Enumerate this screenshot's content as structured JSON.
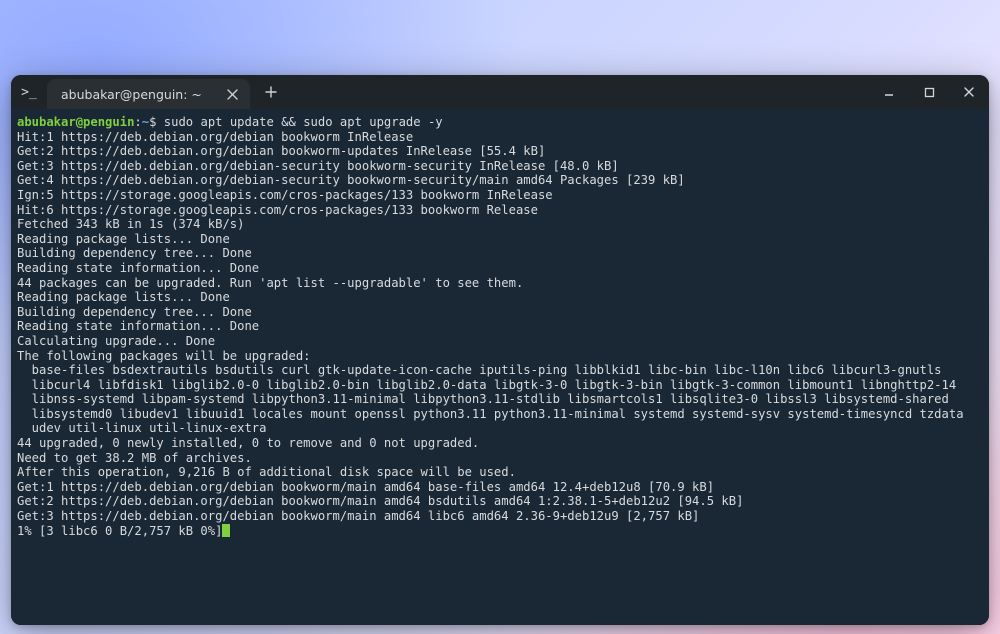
{
  "window": {
    "app_prompt_glyph": ">_",
    "tab_title": "abubakar@penguin: ~",
    "controls": {
      "minimize": "minimize",
      "maximize": "maximize",
      "close": "close"
    }
  },
  "prompt": {
    "user": "abubakar",
    "at": "@",
    "host": "penguin",
    "colon": ":",
    "path": "~",
    "dollar": "$ ",
    "command": "sudo apt update && sudo apt upgrade -y"
  },
  "lines": [
    "Hit:1 https://deb.debian.org/debian bookworm InRelease",
    "Get:2 https://deb.debian.org/debian bookworm-updates InRelease [55.4 kB]",
    "Get:3 https://deb.debian.org/debian-security bookworm-security InRelease [48.0 kB]",
    "Get:4 https://deb.debian.org/debian-security bookworm-security/main amd64 Packages [239 kB]",
    "Ign:5 https://storage.googleapis.com/cros-packages/133 bookworm InRelease",
    "Hit:6 https://storage.googleapis.com/cros-packages/133 bookworm Release",
    "Fetched 343 kB in 1s (374 kB/s)",
    "Reading package lists... Done",
    "Building dependency tree... Done",
    "Reading state information... Done",
    "44 packages can be upgraded. Run 'apt list --upgradable' to see them.",
    "Reading package lists... Done",
    "Building dependency tree... Done",
    "Reading state information... Done",
    "Calculating upgrade... Done",
    "The following packages will be upgraded:",
    "  base-files bsdextrautils bsdutils curl gtk-update-icon-cache iputils-ping libblkid1 libc-bin libc-l10n libc6 libcurl3-gnutls",
    "  libcurl4 libfdisk1 libglib2.0-0 libglib2.0-bin libglib2.0-data libgtk-3-0 libgtk-3-bin libgtk-3-common libmount1 libnghttp2-14",
    "  libnss-systemd libpam-systemd libpython3.11-minimal libpython3.11-stdlib libsmartcols1 libsqlite3-0 libssl3 libsystemd-shared",
    "  libsystemd0 libudev1 libuuid1 locales mount openssl python3.11 python3.11-minimal systemd systemd-sysv systemd-timesyncd tzdata",
    "  udev util-linux util-linux-extra",
    "44 upgraded, 0 newly installed, 0 to remove and 0 not upgraded.",
    "Need to get 38.2 MB of archives.",
    "After this operation, 9,216 B of additional disk space will be used.",
    "Get:1 https://deb.debian.org/debian bookworm/main amd64 base-files amd64 12.4+deb12u8 [70.9 kB]",
    "Get:2 https://deb.debian.org/debian bookworm/main amd64 bsdutils amd64 1:2.38.1-5+deb12u2 [94.5 kB]",
    "Get:3 https://deb.debian.org/debian bookworm/main amd64 libc6 amd64 2.36-9+deb12u9 [2,757 kB]"
  ],
  "progress": "1% [3 libc6 0 B/2,757 kB 0%]"
}
